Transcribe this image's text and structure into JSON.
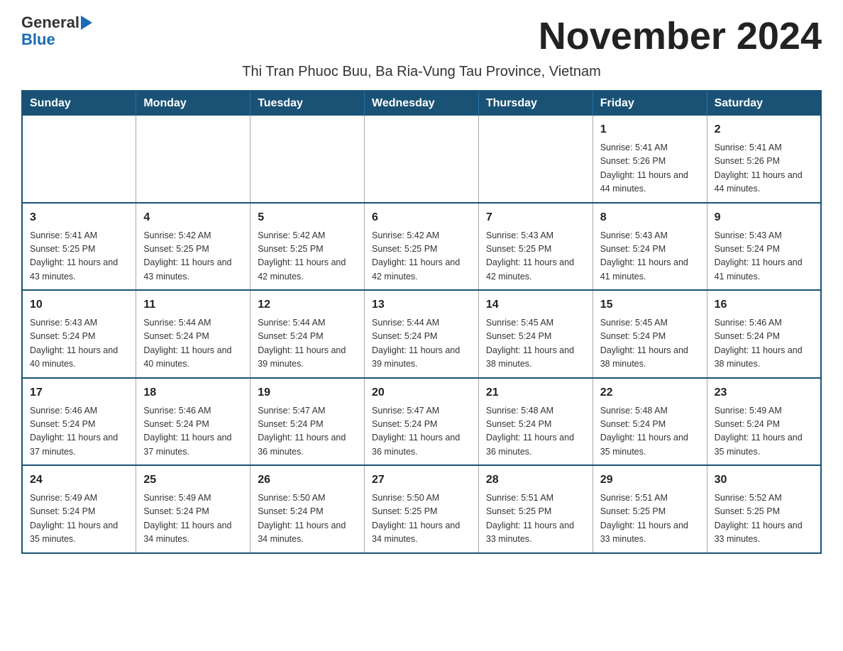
{
  "header": {
    "logo_line1": "General",
    "logo_arrow": true,
    "logo_line2": "Blue",
    "month_title": "November 2024",
    "location": "Thi Tran Phuoc Buu, Ba Ria-Vung Tau Province, Vietnam"
  },
  "weekdays": [
    "Sunday",
    "Monday",
    "Tuesday",
    "Wednesday",
    "Thursday",
    "Friday",
    "Saturday"
  ],
  "weeks": [
    [
      {
        "day": "",
        "sunrise": "",
        "sunset": "",
        "daylight": ""
      },
      {
        "day": "",
        "sunrise": "",
        "sunset": "",
        "daylight": ""
      },
      {
        "day": "",
        "sunrise": "",
        "sunset": "",
        "daylight": ""
      },
      {
        "day": "",
        "sunrise": "",
        "sunset": "",
        "daylight": ""
      },
      {
        "day": "",
        "sunrise": "",
        "sunset": "",
        "daylight": ""
      },
      {
        "day": "1",
        "sunrise": "Sunrise: 5:41 AM",
        "sunset": "Sunset: 5:26 PM",
        "daylight": "Daylight: 11 hours and 44 minutes."
      },
      {
        "day": "2",
        "sunrise": "Sunrise: 5:41 AM",
        "sunset": "Sunset: 5:26 PM",
        "daylight": "Daylight: 11 hours and 44 minutes."
      }
    ],
    [
      {
        "day": "3",
        "sunrise": "Sunrise: 5:41 AM",
        "sunset": "Sunset: 5:25 PM",
        "daylight": "Daylight: 11 hours and 43 minutes."
      },
      {
        "day": "4",
        "sunrise": "Sunrise: 5:42 AM",
        "sunset": "Sunset: 5:25 PM",
        "daylight": "Daylight: 11 hours and 43 minutes."
      },
      {
        "day": "5",
        "sunrise": "Sunrise: 5:42 AM",
        "sunset": "Sunset: 5:25 PM",
        "daylight": "Daylight: 11 hours and 42 minutes."
      },
      {
        "day": "6",
        "sunrise": "Sunrise: 5:42 AM",
        "sunset": "Sunset: 5:25 PM",
        "daylight": "Daylight: 11 hours and 42 minutes."
      },
      {
        "day": "7",
        "sunrise": "Sunrise: 5:43 AM",
        "sunset": "Sunset: 5:25 PM",
        "daylight": "Daylight: 11 hours and 42 minutes."
      },
      {
        "day": "8",
        "sunrise": "Sunrise: 5:43 AM",
        "sunset": "Sunset: 5:24 PM",
        "daylight": "Daylight: 11 hours and 41 minutes."
      },
      {
        "day": "9",
        "sunrise": "Sunrise: 5:43 AM",
        "sunset": "Sunset: 5:24 PM",
        "daylight": "Daylight: 11 hours and 41 minutes."
      }
    ],
    [
      {
        "day": "10",
        "sunrise": "Sunrise: 5:43 AM",
        "sunset": "Sunset: 5:24 PM",
        "daylight": "Daylight: 11 hours and 40 minutes."
      },
      {
        "day": "11",
        "sunrise": "Sunrise: 5:44 AM",
        "sunset": "Sunset: 5:24 PM",
        "daylight": "Daylight: 11 hours and 40 minutes."
      },
      {
        "day": "12",
        "sunrise": "Sunrise: 5:44 AM",
        "sunset": "Sunset: 5:24 PM",
        "daylight": "Daylight: 11 hours and 39 minutes."
      },
      {
        "day": "13",
        "sunrise": "Sunrise: 5:44 AM",
        "sunset": "Sunset: 5:24 PM",
        "daylight": "Daylight: 11 hours and 39 minutes."
      },
      {
        "day": "14",
        "sunrise": "Sunrise: 5:45 AM",
        "sunset": "Sunset: 5:24 PM",
        "daylight": "Daylight: 11 hours and 38 minutes."
      },
      {
        "day": "15",
        "sunrise": "Sunrise: 5:45 AM",
        "sunset": "Sunset: 5:24 PM",
        "daylight": "Daylight: 11 hours and 38 minutes."
      },
      {
        "day": "16",
        "sunrise": "Sunrise: 5:46 AM",
        "sunset": "Sunset: 5:24 PM",
        "daylight": "Daylight: 11 hours and 38 minutes."
      }
    ],
    [
      {
        "day": "17",
        "sunrise": "Sunrise: 5:46 AM",
        "sunset": "Sunset: 5:24 PM",
        "daylight": "Daylight: 11 hours and 37 minutes."
      },
      {
        "day": "18",
        "sunrise": "Sunrise: 5:46 AM",
        "sunset": "Sunset: 5:24 PM",
        "daylight": "Daylight: 11 hours and 37 minutes."
      },
      {
        "day": "19",
        "sunrise": "Sunrise: 5:47 AM",
        "sunset": "Sunset: 5:24 PM",
        "daylight": "Daylight: 11 hours and 36 minutes."
      },
      {
        "day": "20",
        "sunrise": "Sunrise: 5:47 AM",
        "sunset": "Sunset: 5:24 PM",
        "daylight": "Daylight: 11 hours and 36 minutes."
      },
      {
        "day": "21",
        "sunrise": "Sunrise: 5:48 AM",
        "sunset": "Sunset: 5:24 PM",
        "daylight": "Daylight: 11 hours and 36 minutes."
      },
      {
        "day": "22",
        "sunrise": "Sunrise: 5:48 AM",
        "sunset": "Sunset: 5:24 PM",
        "daylight": "Daylight: 11 hours and 35 minutes."
      },
      {
        "day": "23",
        "sunrise": "Sunrise: 5:49 AM",
        "sunset": "Sunset: 5:24 PM",
        "daylight": "Daylight: 11 hours and 35 minutes."
      }
    ],
    [
      {
        "day": "24",
        "sunrise": "Sunrise: 5:49 AM",
        "sunset": "Sunset: 5:24 PM",
        "daylight": "Daylight: 11 hours and 35 minutes."
      },
      {
        "day": "25",
        "sunrise": "Sunrise: 5:49 AM",
        "sunset": "Sunset: 5:24 PM",
        "daylight": "Daylight: 11 hours and 34 minutes."
      },
      {
        "day": "26",
        "sunrise": "Sunrise: 5:50 AM",
        "sunset": "Sunset: 5:24 PM",
        "daylight": "Daylight: 11 hours and 34 minutes."
      },
      {
        "day": "27",
        "sunrise": "Sunrise: 5:50 AM",
        "sunset": "Sunset: 5:25 PM",
        "daylight": "Daylight: 11 hours and 34 minutes."
      },
      {
        "day": "28",
        "sunrise": "Sunrise: 5:51 AM",
        "sunset": "Sunset: 5:25 PM",
        "daylight": "Daylight: 11 hours and 33 minutes."
      },
      {
        "day": "29",
        "sunrise": "Sunrise: 5:51 AM",
        "sunset": "Sunset: 5:25 PM",
        "daylight": "Daylight: 11 hours and 33 minutes."
      },
      {
        "day": "30",
        "sunrise": "Sunrise: 5:52 AM",
        "sunset": "Sunset: 5:25 PM",
        "daylight": "Daylight: 11 hours and 33 minutes."
      }
    ]
  ]
}
